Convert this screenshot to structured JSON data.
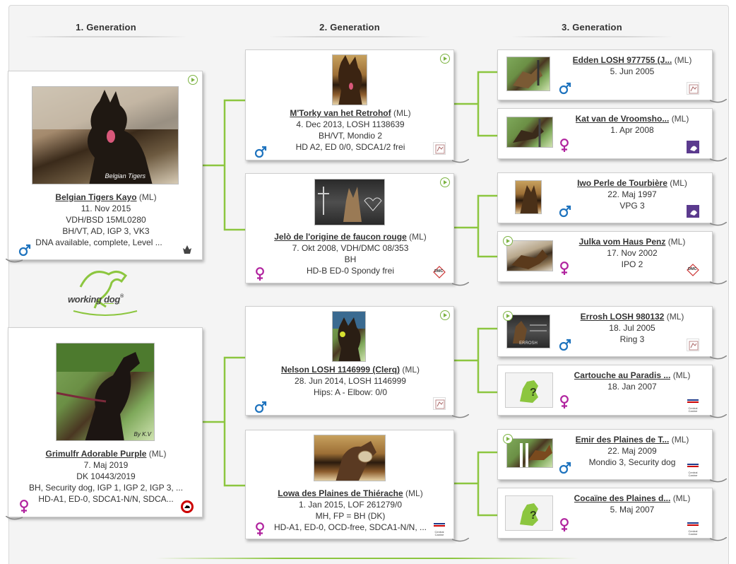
{
  "headers": [
    "1. Generation",
    "2. Generation",
    "3. Generation"
  ],
  "logo": {
    "word1": "working",
    "word2": "dog",
    "tm": "®"
  },
  "ml": "(ML)",
  "gen1": [
    {
      "name": "Belgian Tigers Kayo",
      "lines": [
        "11. Nov 2015",
        "VDH/BSD 15ML0280",
        "BH/VT, AD, IGP 3, VK3",
        "DNA available, complete, Level ..."
      ],
      "sex": "male",
      "photo_caption": "Belgian Tigers"
    },
    {
      "name": "Grimulfr Adorable Purple",
      "lines": [
        "7. Maj 2019",
        "DK 10443/2019",
        "BH, Security dog, IGP 1, IGP 2, IGP 3, ...",
        "HD-A1, ED-0, SDCA1-N/N, SDCA..."
      ],
      "sex": "female",
      "photo_caption": "By K.V"
    }
  ],
  "gen2": [
    {
      "name": "M'Torky van het Retrohof",
      "lines": [
        "4. Dec 2013, LOSH 1138639",
        "BH/VT, Mondio 2",
        "HD A2, ED 0/0, SDCA1/2 frei"
      ],
      "sex": "male"
    },
    {
      "name": "Jelò de l'origine de faucon rouge",
      "lines": [
        "7. Okt 2008, VDH/DMC 08/353",
        "BH",
        "HD-B ED-0 Spondy frei"
      ],
      "sex": "female",
      "club_text": "DMC"
    },
    {
      "name": "Nelson LOSH 1146999 (Clerq)",
      "lines": [
        "28. Jun 2014, LOSH 1146999",
        "Hips: A - Elbow: 0/0"
      ],
      "sex": "male"
    },
    {
      "name": "Lowa des Plaines de Thiérache",
      "lines": [
        "1. Jan 2015, LOF 261279/0",
        "MH, FP = BH (DK)",
        "HD-A1, ED-0, OCD-free, SDCA1-N/N, ..."
      ],
      "sex": "female",
      "club_text": "Central Canine"
    }
  ],
  "gen3": [
    {
      "name": "Edden LOSH 977755 (J...",
      "lines": [
        "5. Jun 2005"
      ],
      "sex": "male"
    },
    {
      "name": "Kat van de Vroomsho...",
      "lines": [
        "1. Apr 2008"
      ],
      "sex": "female"
    },
    {
      "name": "Iwo Perle de Tourbière",
      "lines": [
        "22. Maj 1997",
        "VPG 3"
      ],
      "sex": "male"
    },
    {
      "name": "Julka vom Haus Penz",
      "lines": [
        "17. Nov 2002",
        "IPO 2"
      ],
      "sex": "female",
      "club_text": "DMC"
    },
    {
      "name": "Errosh LOSH 980132",
      "lines": [
        "18. Jul 2005",
        "Ring 3"
      ],
      "sex": "male",
      "photo_caption": "ERROSH"
    },
    {
      "name": "Cartouche au Paradis ...",
      "lines": [
        "18. Jan 2007"
      ],
      "sex": "female",
      "club_text": "Central Canine"
    },
    {
      "name": "Emir des Plaines de T...",
      "lines": [
        "22. Maj 2009",
        "Mondio 3, Security dog"
      ],
      "sex": "male",
      "club_text": "Central Canine"
    },
    {
      "name": "Cocaïne des Plaines d...",
      "lines": [
        "5. Maj 2007"
      ],
      "sex": "female",
      "club_text": "Central Canine"
    }
  ],
  "colors": {
    "male": "#1e73be",
    "female": "#b0229e",
    "accent": "#8cc63f",
    "club_purple": "#5b3a8e"
  }
}
